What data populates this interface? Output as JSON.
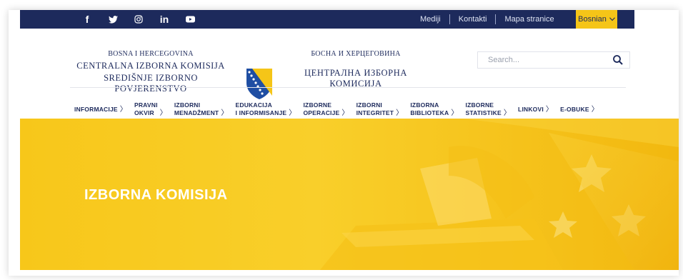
{
  "topbar": {
    "social": [
      {
        "name": "facebook-icon",
        "glyph": "f"
      },
      {
        "name": "twitter-icon",
        "glyph": "❦"
      },
      {
        "name": "instagram-icon",
        "glyph": "◎"
      },
      {
        "name": "linkedin-icon",
        "glyph": "in"
      },
      {
        "name": "youtube-icon",
        "glyph": "▶"
      }
    ],
    "links": [
      "Mediji",
      "Kontakti",
      "Mapa stranice"
    ],
    "language": "Bosnian",
    "bg_color": "#1d2a5c",
    "lang_color": "#f5c518"
  },
  "header": {
    "latin_line1": "BOSNA I HERCEGOVINA",
    "latin_line2": "CENTRALNA IZBORNA KOMISIJA",
    "latin_line3": "SREDIŠNJE IZBORNO POVJERENSTVO",
    "cyrillic_line1": "БОСНА И ХЕРЦЕГОВИНА",
    "cyrillic_line2": "ЦЕНТРАЛНА ИЗБОРНА КОМИСИЈА",
    "search_placeholder": "Search..."
  },
  "nav": {
    "items": [
      {
        "top": "",
        "bottom": "INFORMACIJE"
      },
      {
        "top": "PRAVNI",
        "bottom": "OKVIR"
      },
      {
        "top": "IZBORNI",
        "bottom": "MENADŽMENT"
      },
      {
        "top": "EDUKACIJA",
        "bottom": "I INFORMISANJE"
      },
      {
        "top": "IZBORNE",
        "bottom": "OPERACIJE"
      },
      {
        "top": "IZBORNI",
        "bottom": "INTEGRITET"
      },
      {
        "top": "IZBORNA",
        "bottom": "BIBLIOTEKA"
      },
      {
        "top": "IZBORNE",
        "bottom": "STATISTIKE"
      },
      {
        "top": "",
        "bottom": "LINKOVI"
      },
      {
        "top": "",
        "bottom": "E-OBUKE"
      }
    ],
    "arrow": "〉"
  },
  "hero": {
    "title": "IZBORNA KOMISIJA",
    "bg_color": "#f7c71a"
  }
}
